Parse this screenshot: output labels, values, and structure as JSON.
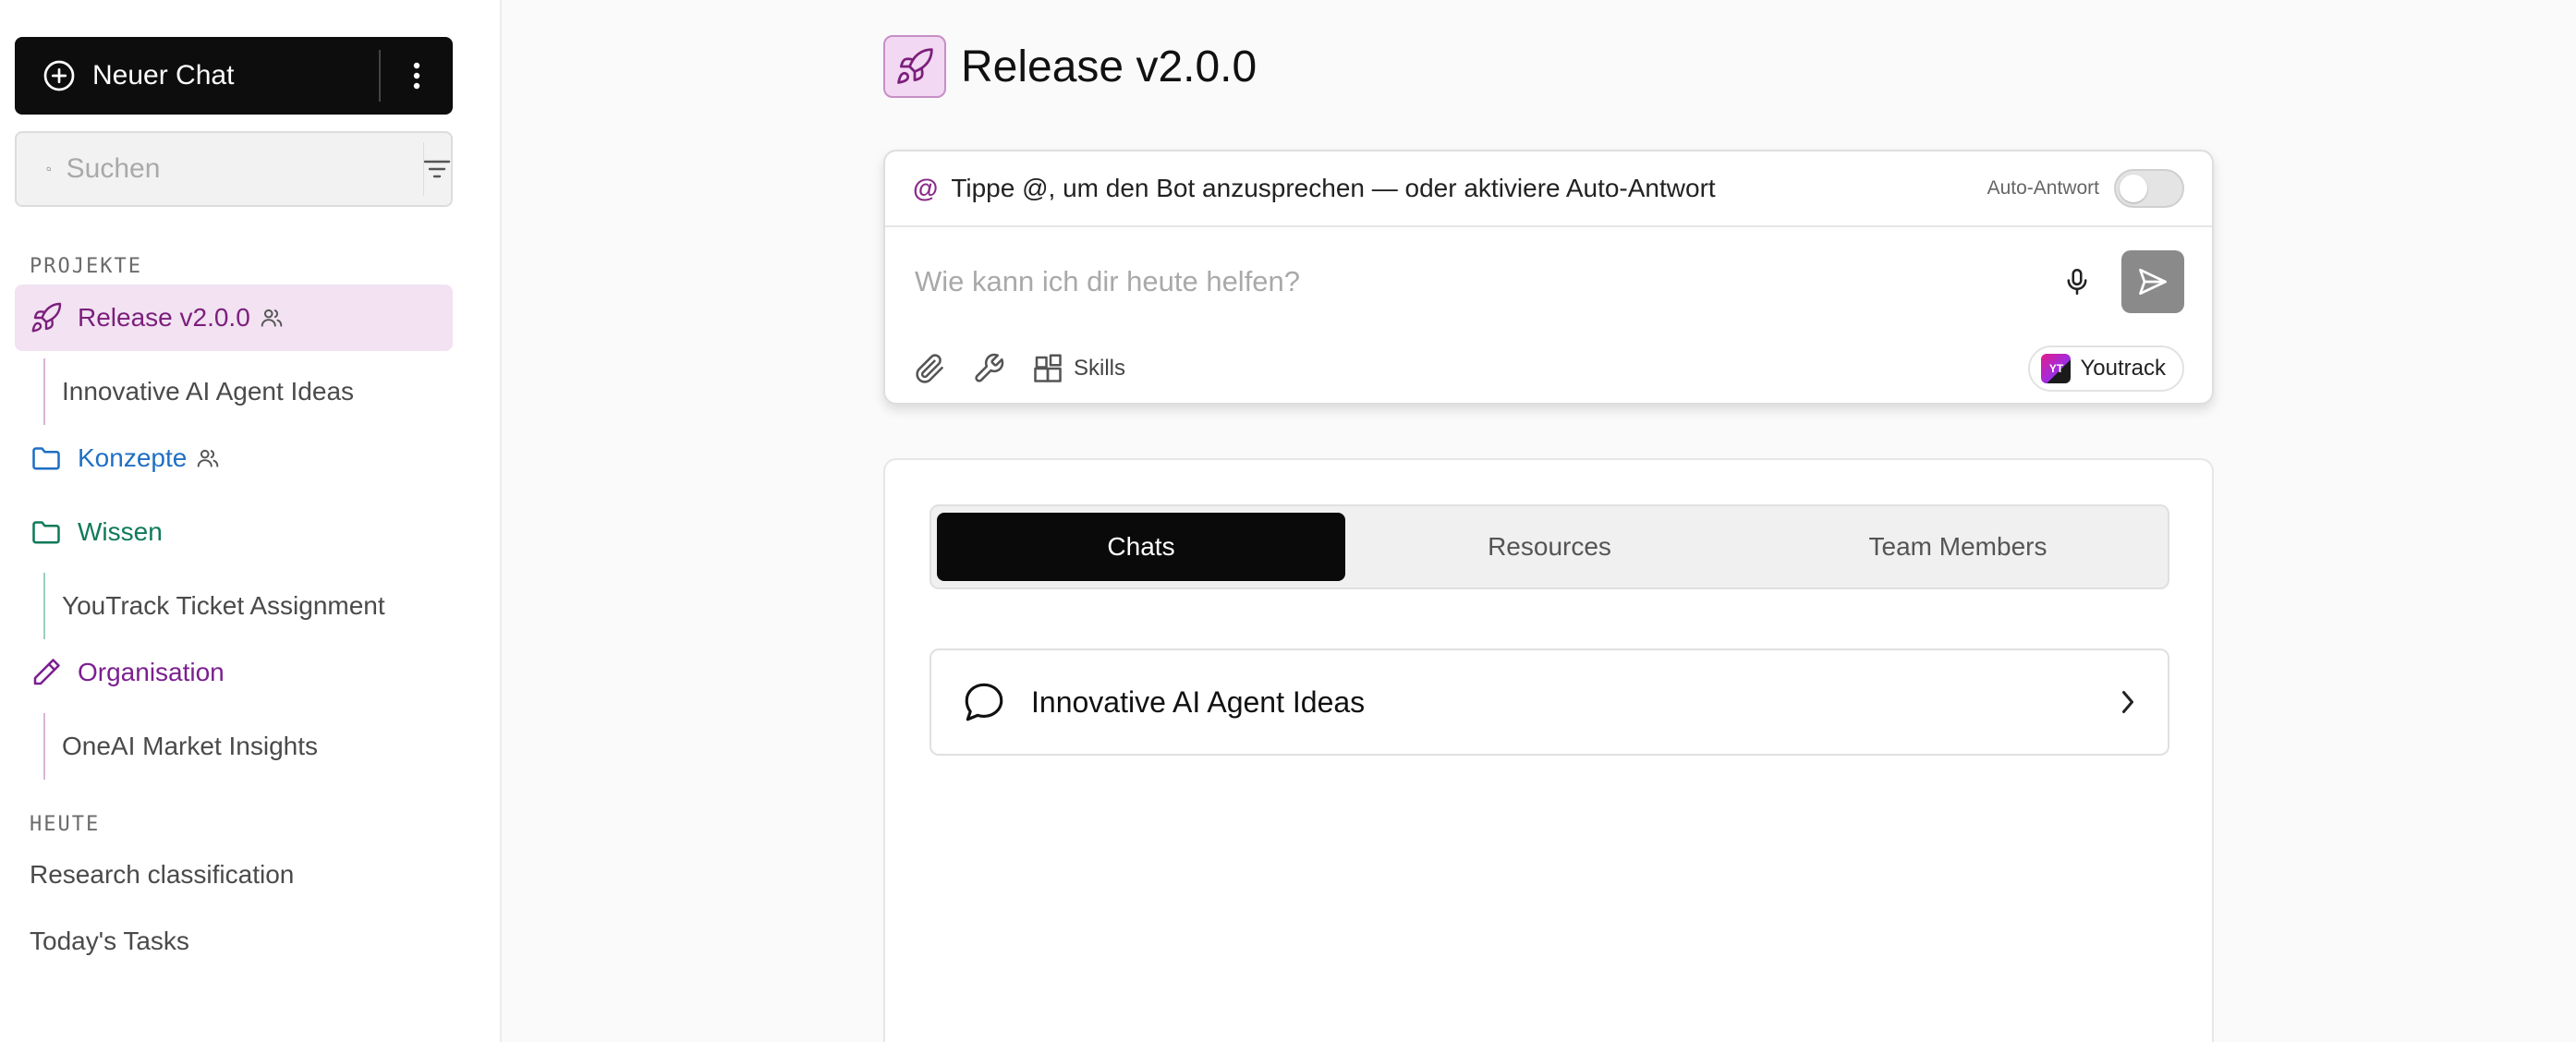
{
  "sidebar": {
    "new_chat_label": "Neuer Chat",
    "search_placeholder": "Suchen",
    "projects_heading": "PROJEKTE",
    "projects": [
      {
        "label": "Release v2.0.0",
        "icon": "rocket-icon",
        "color": "#7b1f7b",
        "shared": true,
        "active": true
      },
      {
        "label": "Konzepte",
        "icon": "folder-icon",
        "color": "#1f6fc4",
        "shared": true
      },
      {
        "label": "Wissen",
        "icon": "folder-icon",
        "color": "#0f7a5a",
        "shared": false
      },
      {
        "label": "Organisation",
        "icon": "pencil-icon",
        "color": "#7b1f8f",
        "shared": false
      }
    ],
    "children": {
      "release": "Innovative AI Agent Ideas",
      "wissen": "YouTrack Ticket Assignment",
      "organisation": "OneAI Market Insights"
    },
    "today_heading": "HEUTE",
    "today_items": [
      "Research classification",
      "Today's Tasks"
    ]
  },
  "main": {
    "title": "Release v2.0.0",
    "composer": {
      "at_symbol": "@",
      "hint": "Tippe @, um den Bot anzusprechen — oder aktiviere Auto-Antwort",
      "auto_reply_label": "Auto-Antwort",
      "auto_reply_on": false,
      "placeholder": "Wie kann ich dir heute helfen?",
      "skills_label": "Skills",
      "integration_label": "Youtrack",
      "integration_logo_text": "YT"
    },
    "tabs": [
      {
        "label": "Chats",
        "active": true
      },
      {
        "label": "Resources",
        "active": false
      },
      {
        "label": "Team Members",
        "active": false
      }
    ],
    "chats": [
      {
        "title": "Innovative AI Agent Ideas"
      }
    ]
  },
  "colors": {
    "accent_purple": "#7b1f7b",
    "active_project_bg": "#f2e2f2",
    "primary_black": "#0d0d0d"
  }
}
